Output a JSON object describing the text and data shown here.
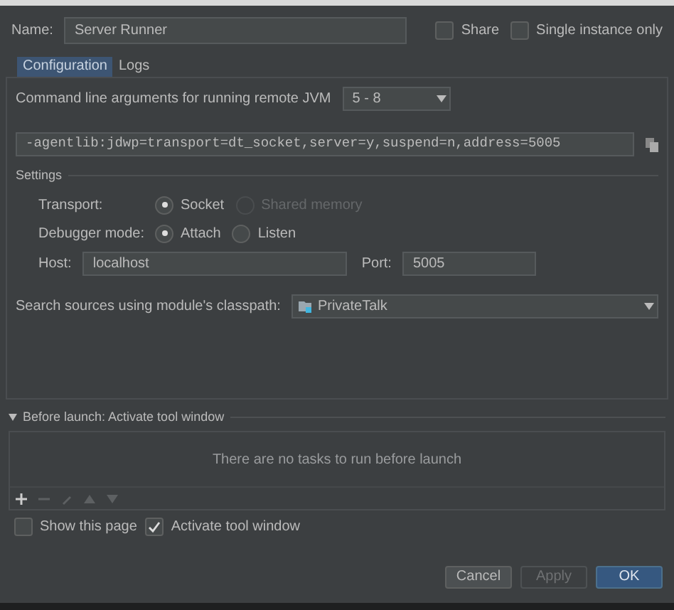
{
  "name_field": {
    "label": "Name:",
    "value": "Server Runner"
  },
  "header_options": [
    {
      "label": "Share",
      "checked": false
    },
    {
      "label": "Single instance only",
      "checked": false
    }
  ],
  "tabs": [
    {
      "label": "Configuration",
      "selected": true
    },
    {
      "label": "Logs",
      "selected": false
    }
  ],
  "jvm": {
    "label": "Command line arguments for running remote JVM",
    "value": "5 - 8"
  },
  "agent_args": "-agentlib:jdwp=transport=dt_socket,server=y,suspend=n,address=5005",
  "settings": {
    "title": "Settings",
    "transport": {
      "label": "Transport:",
      "options": [
        {
          "label": "Socket",
          "selected": true,
          "disabled": false
        },
        {
          "label": "Shared memory",
          "selected": false,
          "disabled": true
        }
      ]
    },
    "debugger_mode": {
      "label": "Debugger mode:",
      "options": [
        {
          "label": "Attach",
          "selected": true,
          "disabled": false
        },
        {
          "label": "Listen",
          "selected": false,
          "disabled": false
        }
      ]
    },
    "host": {
      "label": "Host:",
      "value": "localhost"
    },
    "port": {
      "label": "Port:",
      "value": "5005"
    }
  },
  "classpath": {
    "label": "Search sources using module's classpath:",
    "value": "PrivateTalk"
  },
  "before_launch": {
    "title": "Before launch: Activate tool window",
    "expanded": true,
    "empty_text": "There are no tasks to run before launch"
  },
  "footer_options": [
    {
      "label": "Show this page",
      "checked": false
    },
    {
      "label": "Activate tool window",
      "checked": true
    }
  ],
  "buttons": [
    {
      "label": "Cancel",
      "kind": "normal"
    },
    {
      "label": "Apply",
      "kind": "disabled"
    },
    {
      "label": "OK",
      "kind": "primary"
    }
  ]
}
